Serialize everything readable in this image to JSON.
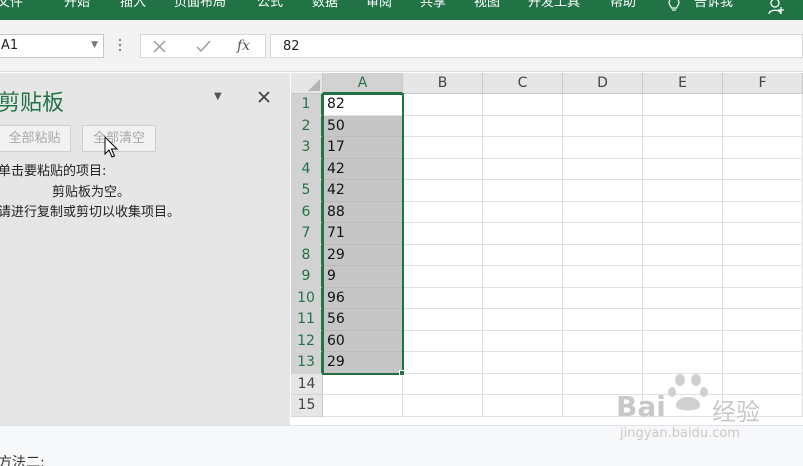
{
  "ribbon": {
    "tabs": [
      "文件",
      "开始",
      "插入",
      "页面布局",
      "公式",
      "数据",
      "审阅",
      "共享",
      "视图",
      "开发工具",
      "帮助"
    ],
    "tell_me": "告诉我",
    "accent": "#217346"
  },
  "formula_bar": {
    "name_box": "A1",
    "formula": "82",
    "cancel_icon": "close-icon",
    "enter_icon": "check-icon",
    "fx_label": "fx"
  },
  "clipboard_pane": {
    "title": "剪贴板",
    "paste_all": "全部粘贴",
    "clear_all": "全部清空",
    "instruction": "单击要粘贴的项目:",
    "empty_message": "剪贴板为空。",
    "hint": "请进行复制或剪切以收集项目。"
  },
  "sheet": {
    "columns": [
      "A",
      "B",
      "C",
      "D",
      "E",
      "F"
    ],
    "rows": [
      1,
      2,
      3,
      4,
      5,
      6,
      7,
      8,
      9,
      10,
      11,
      12,
      13,
      14,
      15
    ],
    "column_a_values": [
      "82",
      "50",
      "17",
      "42",
      "42",
      "88",
      "71",
      "29",
      "9",
      "96",
      "56",
      "60",
      "29"
    ],
    "selection": "A1:A13"
  },
  "caption": "方法二:",
  "watermark": {
    "brand_left": "Bai",
    "brand_right": "经验",
    "url": "jingyan.baidu.com"
  }
}
